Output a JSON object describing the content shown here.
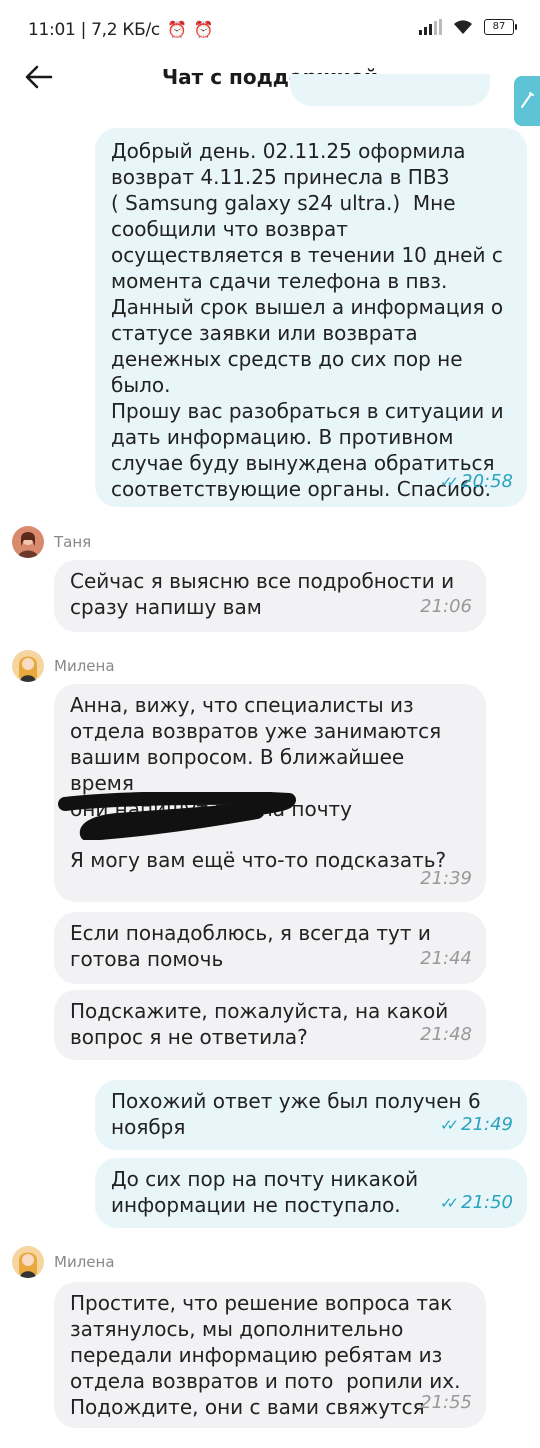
{
  "status_bar": {
    "time_speed": "11:01 | 7,2 КБ/с",
    "battery": "87"
  },
  "header": {
    "title": "Чат с поддержкой"
  },
  "messages": [
    {
      "text": "Добрый день. 02.11.25 оформила\nвозврат 4.11.25 принесла в ПВЗ\n( Samsung galaxy s24 ultra.)  Мне\nсообщили что возврат\nосуществляется в течении 10 дней с\nмомента сдачи телефона в пвз.\nДанный срок вышел а информация о\nстатусе заявки или возврата\nденежных средств до сих пор не было.\nПрошу вас разобраться в ситуации и\nдать информацию. В противном\nслучае буду вынуждена обратиться\nсоответствующие органы. Спасибо.",
      "time": "20:58"
    },
    {
      "sender": "Таня"
    },
    {
      "text": "Сейчас я выясню все подробности и\nсразу напишу вам",
      "time": "21:06"
    },
    {
      "sender": "Милена"
    },
    {
      "text_a": "Анна, вижу, что специалисты из\nотдела возвратов уже занимаются\nвашим вопросом. В ближайшее время\nони напишут вам на почту",
      "text_b": "Я могу вам ещё что-то подсказать?",
      "time": "21:39"
    },
    {
      "text": "Если понадоблюсь, я всегда тут и\nготова помочь",
      "time": "21:44"
    },
    {
      "text": "Подскажите, пожалуйста, на какой\nвопрос я не ответила?",
      "time": "21:48"
    },
    {
      "text": "Похожий ответ уже был получен 6\nноября",
      "time": "21:49"
    },
    {
      "text": "До сих пор на почту никакой\nинформации не поступало.",
      "time": "21:50"
    },
    {
      "sender": "Милена"
    },
    {
      "text": "Простите, что решение вопроса так\nзатянулось, мы дополнительно\nпередали информацию ребятам из\nотдела возвратов и пото  ропили их.\nПодождите, они с вами свяжутся",
      "time": "21:55"
    }
  ],
  "colors": {
    "outgoing_bubble": "#e8f6f9",
    "incoming_bubble": "#f2f2f4",
    "accent_time": "#2aa3bf"
  }
}
